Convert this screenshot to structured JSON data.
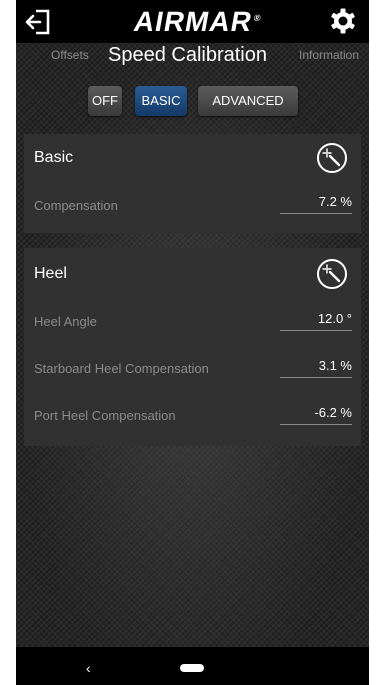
{
  "header": {
    "brand": "AIRMAR",
    "trademark": "®",
    "exit_icon": "exit-icon",
    "settings_icon": "gear-icon"
  },
  "nav": {
    "left": "Offsets",
    "title": "Speed Calibration",
    "right": "Information"
  },
  "mode": {
    "off": "OFF",
    "basic": "BASIC",
    "advanced": "ADVANCED",
    "selected": "BASIC",
    "selected_color": "#1f4c80"
  },
  "basic": {
    "title": "Basic",
    "wand_icon": "magic-wand-icon",
    "fields": [
      {
        "label": "Compensation",
        "value": "7.2 %"
      }
    ]
  },
  "heel": {
    "title": "Heel",
    "wand_icon": "magic-wand-icon",
    "fields": [
      {
        "label": "Heel Angle",
        "value": "12.0 °"
      },
      {
        "label": "Starboard Heel Compensation",
        "value": "3.1 %"
      },
      {
        "label": "Port Heel Compensation",
        "value": "-6.2 %"
      }
    ]
  },
  "system_nav": {
    "back": "‹"
  }
}
